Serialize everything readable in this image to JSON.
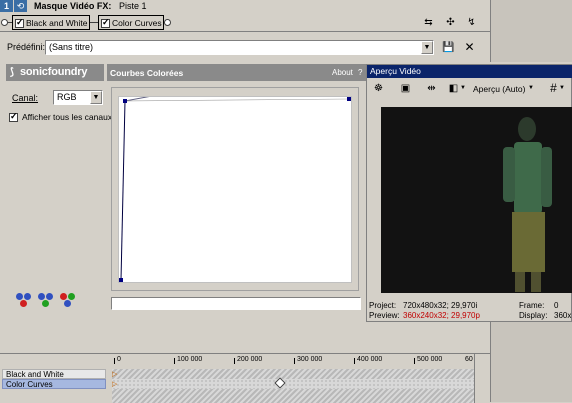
{
  "title_bar": {
    "number": "1",
    "title": "Masque  Vidéo FX:",
    "subtitle": "Piste 1"
  },
  "chain": {
    "items": [
      {
        "label": "Black and White",
        "checked": true
      },
      {
        "label": "Color Curves",
        "checked": true
      }
    ]
  },
  "preset": {
    "label": "Prédéfini:",
    "value": "(Sans titre)"
  },
  "plugin": {
    "brand": "sonicfoundry",
    "name": "Courbes Colorées",
    "about": "About",
    "help": "?"
  },
  "channel": {
    "label": "Canal:",
    "value": "RGB"
  },
  "show_all_channels": {
    "label": "Afficher tous les canaux",
    "checked": true
  },
  "preview": {
    "title": "Aperçu Vidéo",
    "mode": "Aperçu (Auto)",
    "project_label": "Project:",
    "project_value": "720x480x32; 29,970i",
    "preview_label": "Preview:",
    "preview_value": "360x240x32; 29,970p",
    "frame_label": "Frame:",
    "frame_value": "0",
    "display_label": "Display:",
    "display_value": "360x"
  },
  "timeline": {
    "tracks": [
      "Black and White",
      "Color Curves"
    ],
    "ruler": [
      "0",
      "100 000",
      "200 000",
      "300 000",
      "400 000",
      "500 000",
      "60"
    ]
  },
  "colors": {
    "accent": "#3a6ea5",
    "panel_header": "#8a8a8a",
    "preview_title": "#0a246a",
    "preview_value_red": "#c00000"
  }
}
